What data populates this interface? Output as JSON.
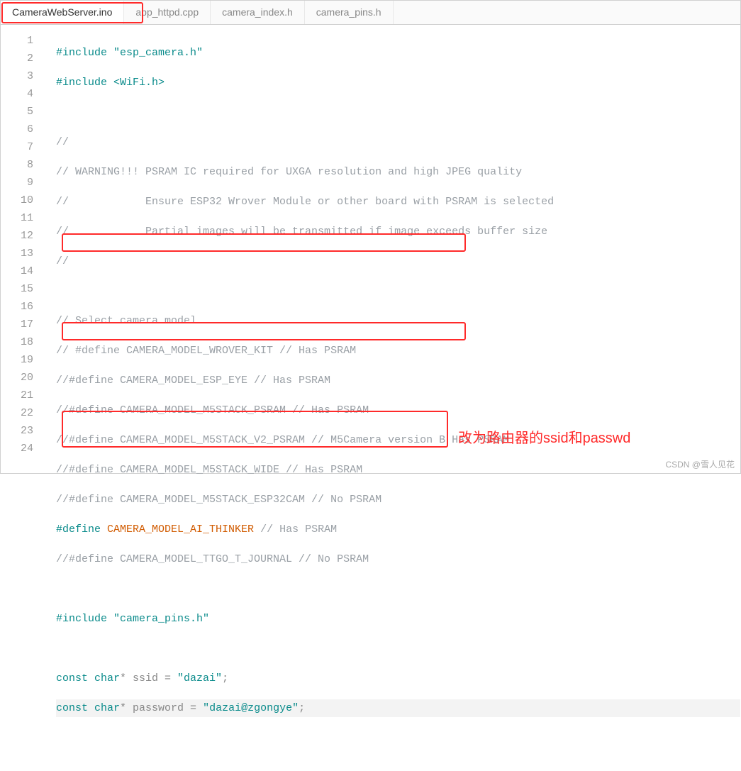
{
  "tabs": [
    {
      "label": "CameraWebServer.ino",
      "active": true
    },
    {
      "label": "app_httpd.cpp",
      "active": false
    },
    {
      "label": "camera_index.h",
      "active": false
    },
    {
      "label": "camera_pins.h",
      "active": false
    }
  ],
  "lines": {
    "n1": "1",
    "n2": "2",
    "n3": "3",
    "n4": "4",
    "n5": "5",
    "n6": "6",
    "n7": "7",
    "n8": "8",
    "n9": "9",
    "n10": "10",
    "n11": "11",
    "n12": "12",
    "n13": "13",
    "n14": "14",
    "n15": "15",
    "n16": "16",
    "n17": "17",
    "n18": "18",
    "n19": "19",
    "n20": "20",
    "n21": "21",
    "n22": "22",
    "n23": "23",
    "n24": "24"
  },
  "code": {
    "l1_pp": "#include ",
    "l1_str": "\"esp_camera.h\"",
    "l2_pp": "#include ",
    "l2_str": "<WiFi.h>",
    "l4": "//",
    "l5": "// WARNING!!! PSRAM IC required for UXGA resolution and high JPEG quality",
    "l6": "//            Ensure ESP32 Wrover Module or other board with PSRAM is selected",
    "l7": "//            Partial images will be transmitted if image exceeds buffer size",
    "l8": "//",
    "l10": "// Select camera model",
    "l11": "// #define CAMERA_MODEL_WROVER_KIT // Has PSRAM",
    "l12": "//#define CAMERA_MODEL_ESP_EYE // Has PSRAM",
    "l13": "//#define CAMERA_MODEL_M5STACK_PSRAM // Has PSRAM",
    "l14": "//#define CAMERA_MODEL_M5STACK_V2_PSRAM // M5Camera version B Has PSRAM",
    "l15": "//#define CAMERA_MODEL_M5STACK_WIDE // Has PSRAM",
    "l16": "//#define CAMERA_MODEL_M5STACK_ESP32CAM // No PSRAM",
    "l17_pp": "#define",
    "l17_macro": " CAMERA_MODEL_AI_THINKER ",
    "l17_cmt": "// Has PSRAM",
    "l18": "//#define CAMERA_MODEL_TTGO_T_JOURNAL // No PSRAM",
    "l20_pp": "#include ",
    "l20_str": "\"camera_pins.h\"",
    "l22_kw1": "const",
    "l22_kw2": " char",
    "l22_txt": "* ssid = ",
    "l22_str": "\"dazai\"",
    "l22_end": ";",
    "l23_kw1": "const",
    "l23_kw2": " char",
    "l23_txt": "* password = ",
    "l23_str": "\"dazai@zgongye\"",
    "l23_end": ";"
  },
  "annotation": "改为路由器的ssid和passwd",
  "watermark": "CSDN @雪人见花"
}
